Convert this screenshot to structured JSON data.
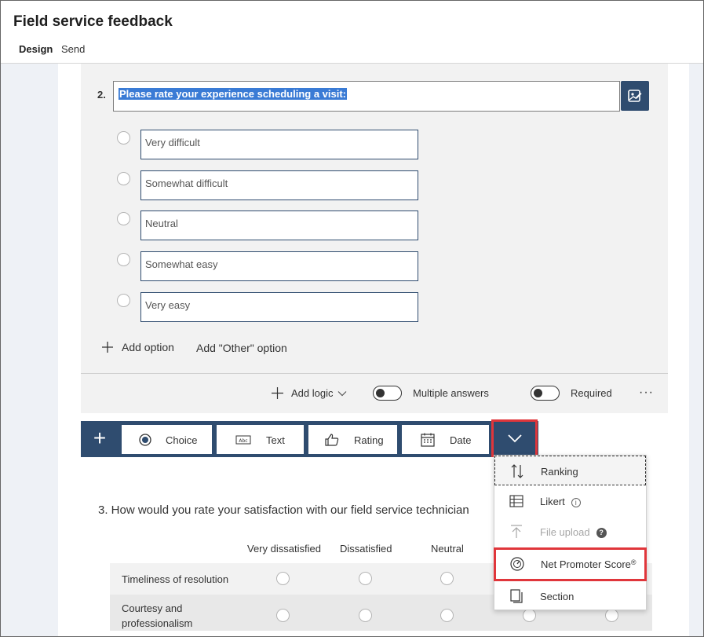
{
  "app": {
    "title": "Field service feedback"
  },
  "nav": {
    "tabs": [
      {
        "label": "Design",
        "active": true
      },
      {
        "label": "Send",
        "active": false
      }
    ]
  },
  "question2": {
    "number": "2.",
    "title": "Please rate your experience scheduling a visit:",
    "options": [
      "Very difficult",
      "Somewhat difficult",
      "Neutral",
      "Somewhat easy",
      "Very easy"
    ],
    "add_option_label": "Add option",
    "add_other_label": "Add \"Other\" option",
    "add_logic_label": "Add logic",
    "multiple_answers_label": "Multiple answers",
    "required_label": "Required",
    "more_label": "···"
  },
  "type_bar": {
    "add_symbol": "+",
    "types": [
      {
        "label": "Choice",
        "icon": "radio-icon"
      },
      {
        "label": "Text",
        "icon": "text-icon"
      },
      {
        "label": "Rating",
        "icon": "thumbs-up-icon"
      },
      {
        "label": "Date",
        "icon": "calendar-icon"
      }
    ],
    "more_types_icon": "chevron-down-icon"
  },
  "dropdown": {
    "items": [
      {
        "label": "Ranking",
        "icon": "ranking-icon",
        "state": "focused"
      },
      {
        "label": "Likert",
        "icon": "likert-icon",
        "state": "normal",
        "badge": "i"
      },
      {
        "label": "File upload",
        "icon": "upload-icon",
        "state": "disabled",
        "badge": "?"
      },
      {
        "label": "Net Promoter Score",
        "icon": "gauge-icon",
        "state": "highlighted",
        "badge": "®"
      },
      {
        "label": "Section",
        "icon": "section-icon",
        "state": "normal"
      }
    ]
  },
  "question3": {
    "title": "3. How would you rate your satisfaction with our field service technician",
    "columns": [
      "Very dissatisfied",
      "Dissatisfied",
      "Neutral"
    ],
    "rows": [
      "Timeliness of resolution",
      "Courtesy and professionalism"
    ]
  },
  "colors": {
    "accent": "#2f4c6f",
    "highlight_border": "#e0363b",
    "selection": "#3a7bd5"
  }
}
